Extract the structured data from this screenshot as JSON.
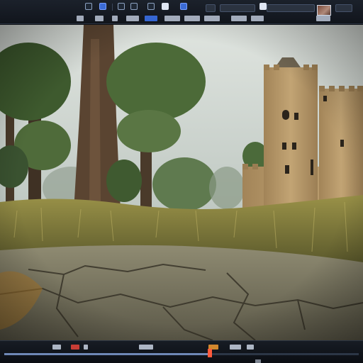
{
  "toolbar": {
    "icons": [
      "layout-icon",
      "grid-icon",
      "move-icon",
      "rotate-icon",
      "scale-icon",
      "camera-icon",
      "light-icon",
      "play-icon",
      "settings-icon",
      "record-icon",
      "render-icon",
      "menu-icon"
    ]
  },
  "viewport": {
    "scene": "castle-forest-render",
    "sky_color": "#cfd6d0",
    "grass_color": "#8a8a3e",
    "stone_color": "#b79767"
  },
  "timeline": {
    "progress": 0.58
  }
}
